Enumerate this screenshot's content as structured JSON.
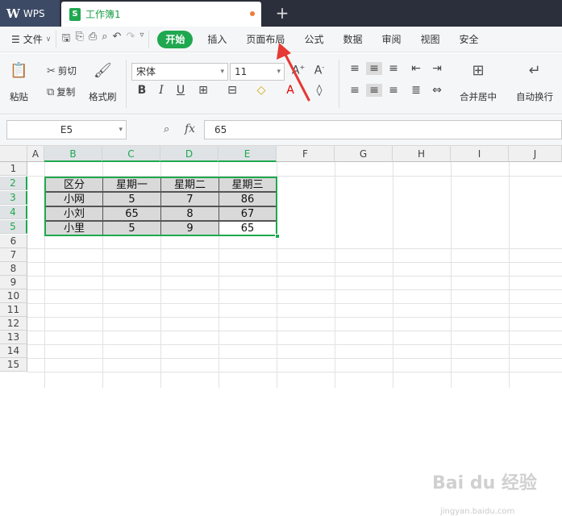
{
  "titlebar": {
    "app_name": "WPS",
    "document_tab": "工作簿1",
    "new_tab": "+"
  },
  "menubar": {
    "file": "文件",
    "items": [
      "开始",
      "插入",
      "页面布局",
      "公式",
      "数据",
      "审阅",
      "视图",
      "安全"
    ]
  },
  "ribbon": {
    "paste": "粘贴",
    "cut": "剪切",
    "copy": "复制",
    "format_painter": "格式刷",
    "font_name": "宋体",
    "font_size": "11",
    "merge_center": "合并居中",
    "wrap_text": "自动换行"
  },
  "formula": {
    "cell_ref": "E5",
    "fx": "fx",
    "value": "65"
  },
  "sheet": {
    "columns": [
      "A",
      "B",
      "C",
      "D",
      "E",
      "F",
      "G",
      "H",
      "I",
      "J"
    ],
    "rows": [
      "1",
      "2",
      "3",
      "4",
      "5",
      "6",
      "7",
      "8",
      "9",
      "10",
      "11",
      "12",
      "13",
      "14",
      "15"
    ],
    "table": [
      [
        "区分",
        "星期一",
        "星期二",
        "星期三"
      ],
      [
        "小网",
        "5",
        "7",
        "86"
      ],
      [
        "小刘",
        "65",
        "8",
        "67"
      ],
      [
        "小里",
        "5",
        "9",
        "65"
      ]
    ],
    "active_cell": "E5"
  },
  "colors": {
    "accent": "#1fa84f",
    "titlebar": "#2b2f3b",
    "annotation_arrow": "#e53935"
  },
  "watermark": {
    "brand": "Bai du 经验",
    "url": "jingyan.baidu.com"
  }
}
